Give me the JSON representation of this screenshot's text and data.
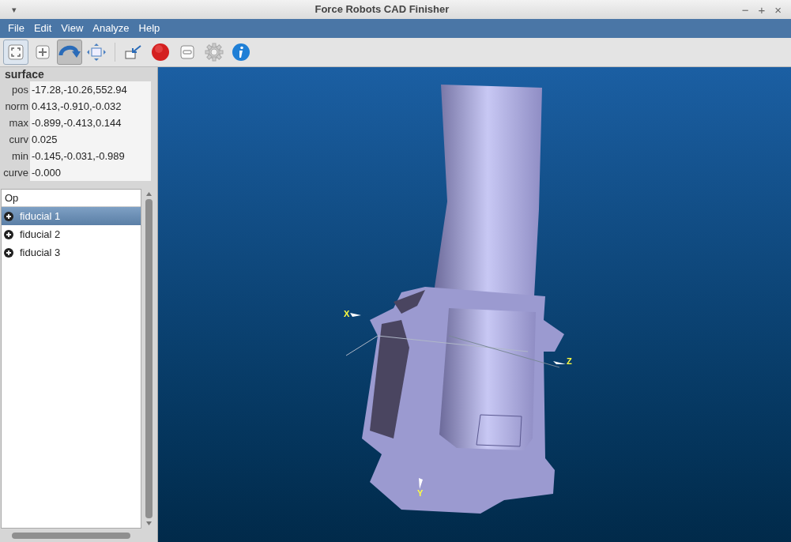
{
  "window": {
    "title": "Force Robots CAD Finisher",
    "menu_icon": "▾",
    "controls": [
      "−",
      "+",
      "×"
    ]
  },
  "menu": [
    "File",
    "Edit",
    "View",
    "Analyze",
    "Help"
  ],
  "toolbar": [
    {
      "kind": "fit",
      "selected": true
    },
    {
      "kind": "add",
      "selected": false
    },
    {
      "kind": "rotate",
      "selected": true
    },
    {
      "kind": "pan",
      "selected": false
    },
    {
      "kind": "import",
      "selected": false
    },
    {
      "kind": "record",
      "selected": false
    },
    {
      "kind": "remove",
      "selected": false
    },
    {
      "kind": "settings",
      "selected": false
    },
    {
      "kind": "info",
      "selected": false
    }
  ],
  "properties": {
    "title": "surface",
    "rows": [
      {
        "label": "pos",
        "value": "-17.28,-10.26,552.94"
      },
      {
        "label": "norm",
        "value": "0.413,-0.910,-0.032"
      },
      {
        "label": "max",
        "value": "-0.899,-0.413,0.144"
      },
      {
        "label": "curv",
        "value": "0.025"
      },
      {
        "label": "min",
        "value": "-0.145,-0.031,-0.989"
      },
      {
        "label": "curve",
        "value": "-0.000"
      }
    ]
  },
  "tree": {
    "header": "Op",
    "items": [
      {
        "label": "fiducial 1",
        "selected": true
      },
      {
        "label": "fiducial 2",
        "selected": false
      },
      {
        "label": "fiducial 3",
        "selected": false
      }
    ]
  },
  "viewport": {
    "axes": [
      {
        "label": "X",
        "kind": "x"
      },
      {
        "label": "Z",
        "kind": "z"
      },
      {
        "label": "Y",
        "kind": "y"
      }
    ]
  }
}
